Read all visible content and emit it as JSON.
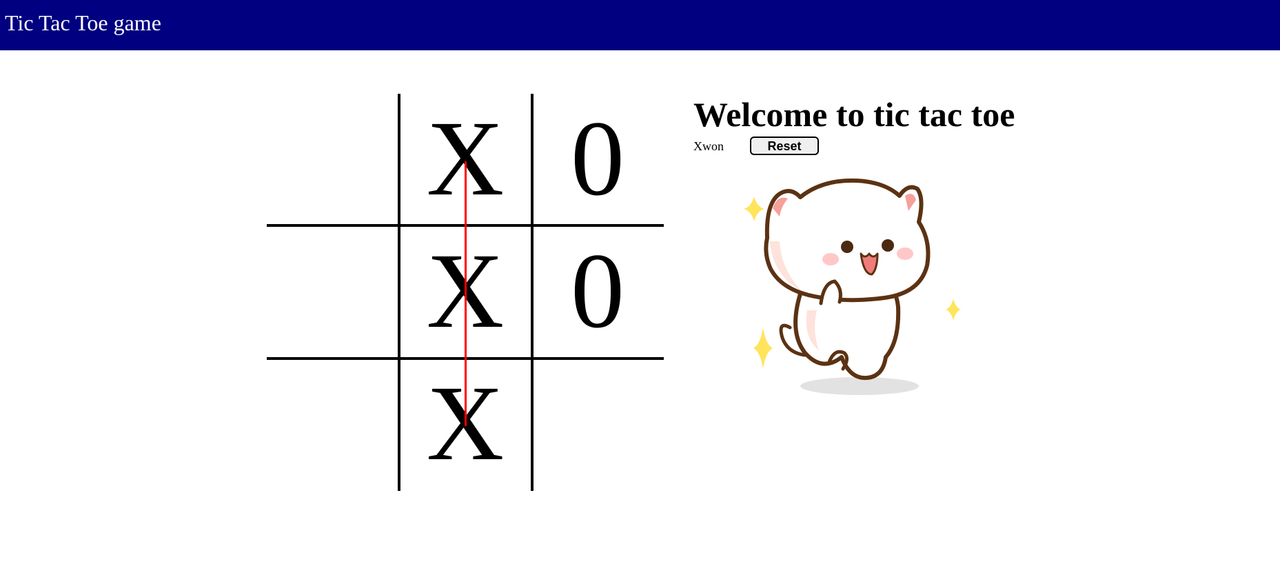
{
  "header": {
    "title": "Tic Tac Toe game",
    "background_color": "#000080"
  },
  "board": {
    "cells": [
      "",
      "X",
      "0",
      "",
      "X",
      "0",
      "",
      "X",
      ""
    ],
    "win_line_color": "#ff0000",
    "win_line": "middle-column"
  },
  "info": {
    "heading": "Welcome to tic tac toe",
    "status": "Xwon",
    "reset_label": "Reset"
  },
  "celebration_image": "cat-celebration-icon"
}
